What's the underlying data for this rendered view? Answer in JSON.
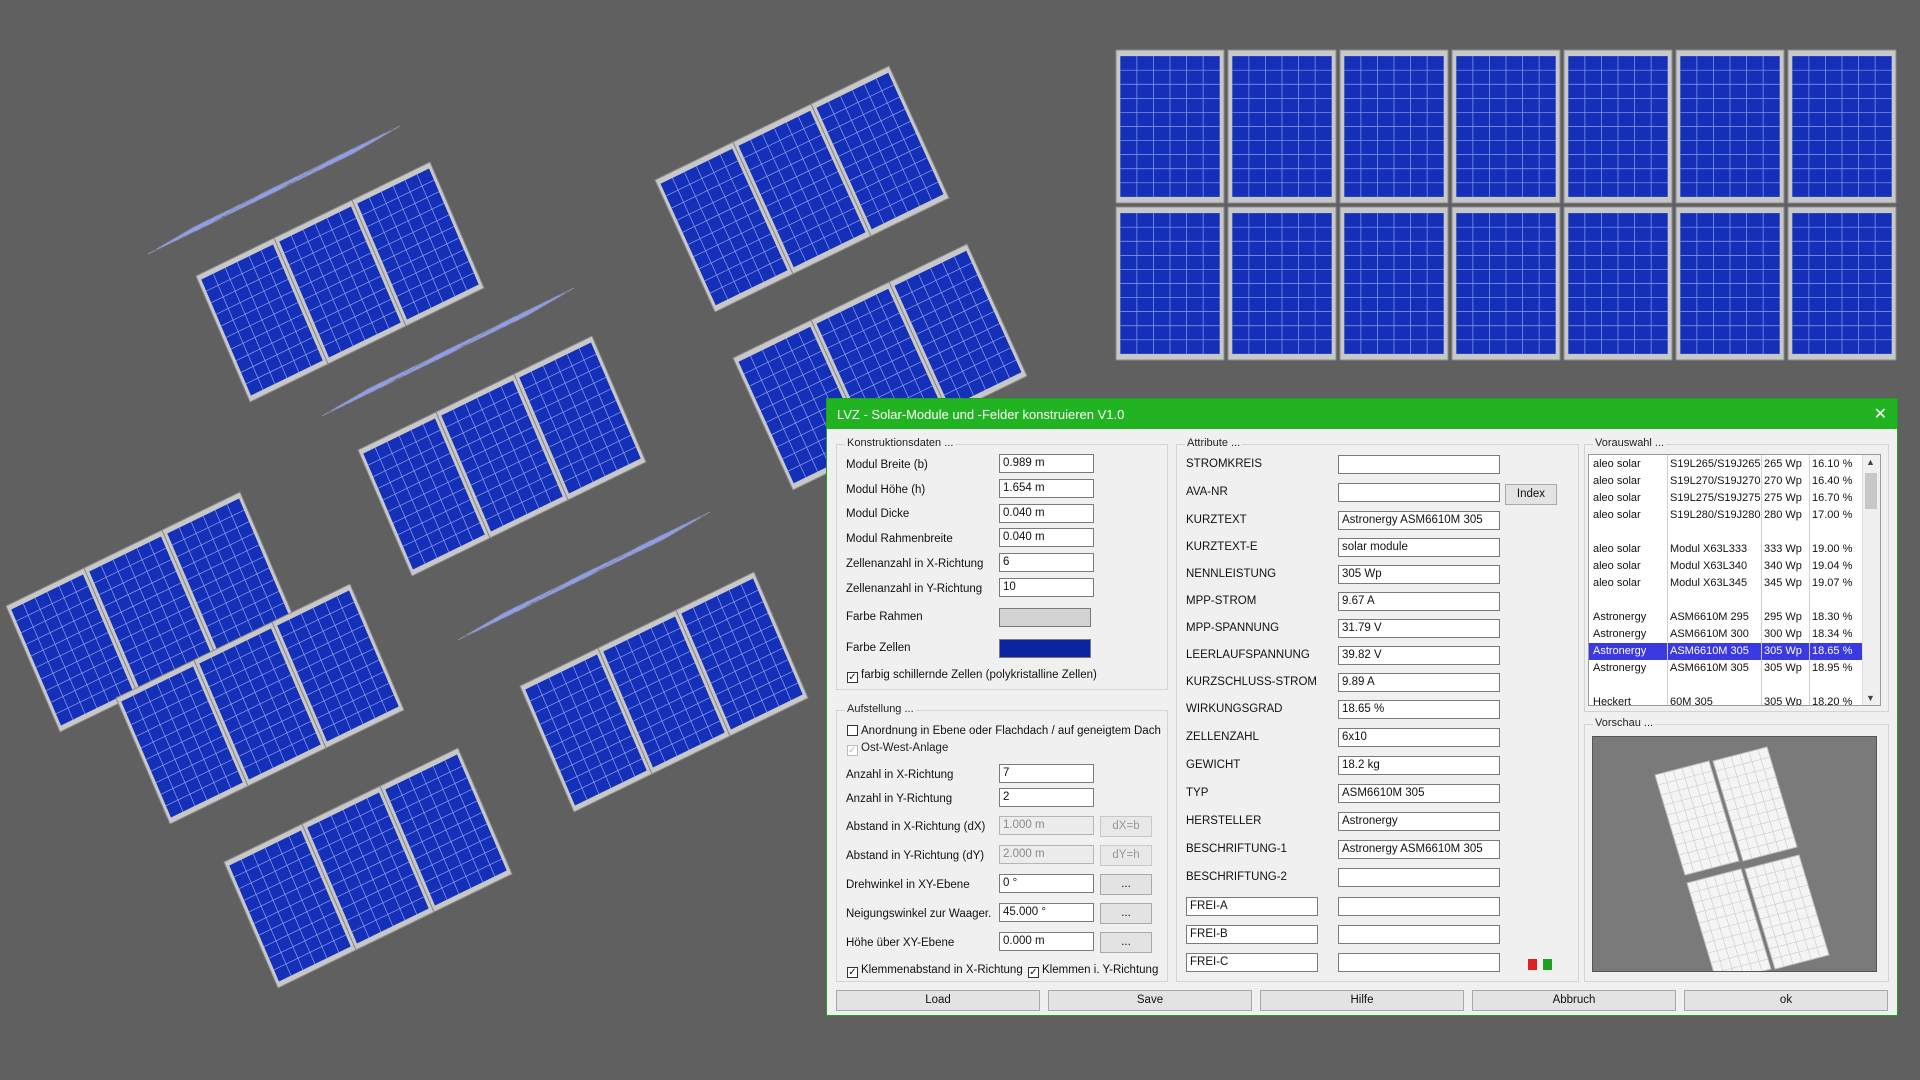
{
  "window": {
    "title": "LVZ - Solar-Module und -Felder konstruieren V1.0",
    "close_glyph": "✕"
  },
  "konstruktion": {
    "title": "Konstruktionsdaten ...",
    "modul_breite_label": "Modul Breite (b)",
    "modul_breite": "0.989 m",
    "modul_hoehe_label": "Modul Höhe  (h)",
    "modul_hoehe": "1.654 m",
    "modul_dicke_label": "Modul Dicke",
    "modul_dicke": "0.040 m",
    "rahmenbreite_label": "Modul Rahmenbreite",
    "rahmenbreite": "0.040 m",
    "zellen_x_label": "Zellenanzahl in X-Richtung",
    "zellen_x": "6",
    "zellen_y_label": "Zellenanzahl in Y-Richtung",
    "zellen_y": "10",
    "farbe_rahmen_label": "Farbe Rahmen",
    "farbe_rahmen": "#d3d3d3",
    "farbe_zellen_label": "Farbe Zellen",
    "farbe_zellen": "#0a239e",
    "schillernd_label": "farbig schillernde Zellen (polykristalline Zellen)",
    "schillernd_checked": "✓"
  },
  "aufstellung": {
    "title": "Aufstellung ...",
    "ebene_label": "Anordnung in Ebene oder Flachdach / auf geneigtem Dach",
    "ebene_checked": "",
    "ostwest_label": "Ost-West-Anlage",
    "ostwest_checked": "✓",
    "anzahl_x_label": "Anzahl in X-Richtung",
    "anzahl_x": "7",
    "anzahl_y_label": "Anzahl in Y-Richtung",
    "anzahl_y": "2",
    "abstand_x_label": "Abstand in X-Richtung (dX)",
    "abstand_x": "1.000 m",
    "abstand_x_btn": "dX=b",
    "abstand_y_label": "Abstand in Y-Richtung (dY)",
    "abstand_y": "2.000 m",
    "abstand_y_btn": "dY=h",
    "drehwinkel_label": "Drehwinkel in XY-Ebene",
    "drehwinkel": "0 °",
    "neigung_label": "Neigungswinkel zur Waager.",
    "neigung": "45.000 °",
    "hoehe_label": "Höhe über XY-Ebene",
    "hoehe": "0.000 m",
    "dots": "...",
    "klemmen_x_label": "Klemmenabstand in X-Richtung",
    "klemmen_x_checked": "✓",
    "klemmen_y_label": "Klemmen i. Y-Richtung",
    "klemmen_y_checked": "✓"
  },
  "attribute": {
    "title": "Attribute ...",
    "index_button": "Index",
    "rows": [
      {
        "label": "STROMKREIS",
        "value": ""
      },
      {
        "label": "AVA-NR",
        "value": ""
      },
      {
        "label": "KURZTEXT",
        "value": "Astronergy ASM6610M 305"
      },
      {
        "label": "KURZTEXT-E",
        "value": "solar module"
      },
      {
        "label": "NENNLEISTUNG",
        "value": "305 Wp"
      },
      {
        "label": "MPP-STROM",
        "value": "9.67 A"
      },
      {
        "label": "MPP-SPANNUNG",
        "value": "31.79 V"
      },
      {
        "label": "LEERLAUFSPANNUNG",
        "value": "39.82 V"
      },
      {
        "label": "KURZSCHLUSS-STROM",
        "value": "9.89 A"
      },
      {
        "label": "WIRKUNGSGRAD",
        "value": "18.65 %"
      },
      {
        "label": "ZELLENZAHL",
        "value": "6x10"
      },
      {
        "label": "GEWICHT",
        "value": "18.2 kg"
      },
      {
        "label": "TYP",
        "value": "ASM6610M 305"
      },
      {
        "label": "HERSTELLER",
        "value": "Astronergy"
      },
      {
        "label": "BESCHRIFTUNG-1",
        "value": "Astronergy ASM6610M 305"
      },
      {
        "label": "BESCHRIFTUNG-2",
        "value": ""
      }
    ],
    "frei": [
      {
        "label": "FREI-A",
        "value": ""
      },
      {
        "label": "FREI-B",
        "value": ""
      },
      {
        "label": "FREI-C",
        "value": ""
      }
    ],
    "indicator_red": "#e02020",
    "indicator_green": "#20a020"
  },
  "vorauswahl": {
    "title": "Vorauswahl ...",
    "rows": [
      {
        "brand": "aleo solar",
        "model": "S19L265/S19J265",
        "power": "265 Wp",
        "eff": "16.10 %",
        "selected": false
      },
      {
        "brand": "aleo solar",
        "model": "S19L270/S19J270",
        "power": "270 Wp",
        "eff": "16.40 %",
        "selected": false
      },
      {
        "brand": "aleo solar",
        "model": "S19L275/S19J275",
        "power": "275 Wp",
        "eff": "16.70 %",
        "selected": false
      },
      {
        "brand": "aleo solar",
        "model": "S19L280/S19J280",
        "power": "280 Wp",
        "eff": "17.00 %",
        "selected": false
      },
      {
        "brand": "",
        "model": "",
        "power": "",
        "eff": "",
        "selected": false
      },
      {
        "brand": "aleo solar",
        "model": "Modul X63L333",
        "power": "333 Wp",
        "eff": "19.00 %",
        "selected": false
      },
      {
        "brand": "aleo solar",
        "model": "Modul X63L340",
        "power": "340 Wp",
        "eff": "19.04 %",
        "selected": false
      },
      {
        "brand": "aleo solar",
        "model": "Modul X63L345",
        "power": "345 Wp",
        "eff": "19.07 %",
        "selected": false
      },
      {
        "brand": "",
        "model": "",
        "power": "",
        "eff": "",
        "selected": false
      },
      {
        "brand": "Astronergy",
        "model": "ASM6610M 295",
        "power": "295 Wp",
        "eff": "18.30 %",
        "selected": false
      },
      {
        "brand": "Astronergy",
        "model": "ASM6610M 300",
        "power": "300 Wp",
        "eff": "18.34 %",
        "selected": false
      },
      {
        "brand": "Astronergy",
        "model": "ASM6610M 305",
        "power": "305 Wp",
        "eff": "18.65 %",
        "selected": true
      },
      {
        "brand": "Astronergy",
        "model": "ASM6610M 305",
        "power": "305 Wp",
        "eff": "18.95 %",
        "selected": false
      },
      {
        "brand": "",
        "model": "",
        "power": "",
        "eff": "",
        "selected": false
      },
      {
        "brand": "Heckert",
        "model": "60M 305",
        "power": "305 Wp",
        "eff": "18.20 %",
        "selected": false
      }
    ],
    "scroll_up": "▲",
    "scroll_down": "▼"
  },
  "vorschau": {
    "title": "Vorschau ..."
  },
  "footer": {
    "load": "Load",
    "save": "Save",
    "hilfe": "Hilfe",
    "abbruch": "Abbruch",
    "ok": "ok"
  },
  "colors": {
    "panel_blue": "#1530b8",
    "frame": "#c8c8c8",
    "background": "#606060",
    "title_green": "#22b322",
    "selection": "#3a3ae0"
  }
}
